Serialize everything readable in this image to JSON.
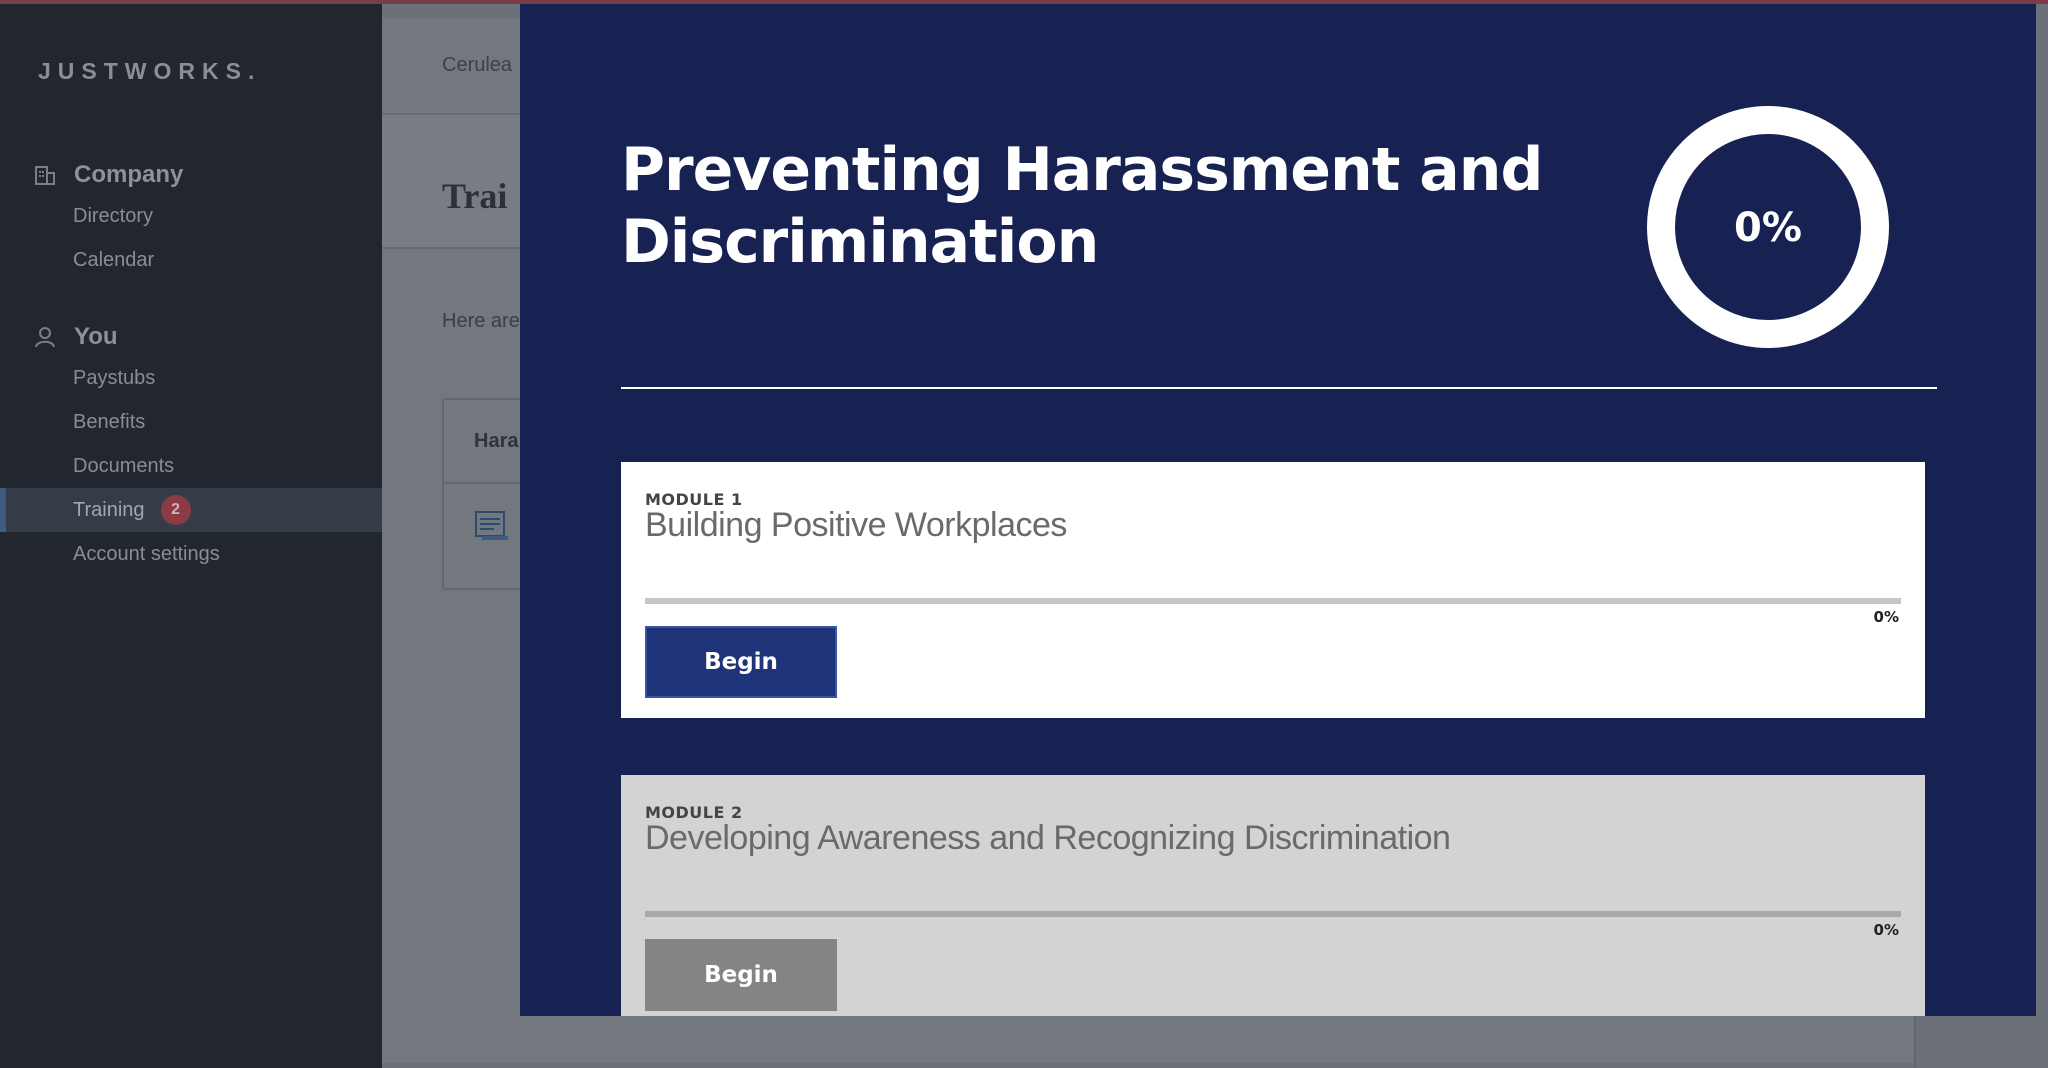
{
  "sidebar": {
    "logo": "JUSTWORKS.",
    "sections": [
      {
        "header": "Company",
        "icon": "building-icon",
        "items": [
          {
            "label": "Directory"
          },
          {
            "label": "Calendar"
          }
        ]
      },
      {
        "header": "You",
        "icon": "user-icon",
        "items": [
          {
            "label": "Paystubs"
          },
          {
            "label": "Benefits"
          },
          {
            "label": "Documents"
          },
          {
            "label": "Training",
            "badge": "2",
            "active": true
          },
          {
            "label": "Account settings"
          }
        ]
      }
    ]
  },
  "background": {
    "breadcrumb": "Cerulea",
    "title": "Trai",
    "intro": "Here are",
    "card_title": "Hara"
  },
  "modal": {
    "title": "Preventing Harassment and Discrimination",
    "progress_label": "0%",
    "progress": 0,
    "modules": [
      {
        "label": "MODULE 1",
        "title": "Building Positive Workplaces",
        "progress": 0,
        "progress_label": "0%",
        "button": "Begin",
        "enabled": true
      },
      {
        "label": "MODULE 2",
        "title": "Developing Awareness and Recognizing Discrimination",
        "progress": 0,
        "progress_label": "0%",
        "button": "Begin",
        "enabled": false
      }
    ]
  },
  "colors": {
    "modal_bg": "#172252",
    "primary_button": "#1f3478",
    "disabled_button": "#848484",
    "sidebar_bg": "#22262e",
    "badge": "#8a3b45"
  }
}
